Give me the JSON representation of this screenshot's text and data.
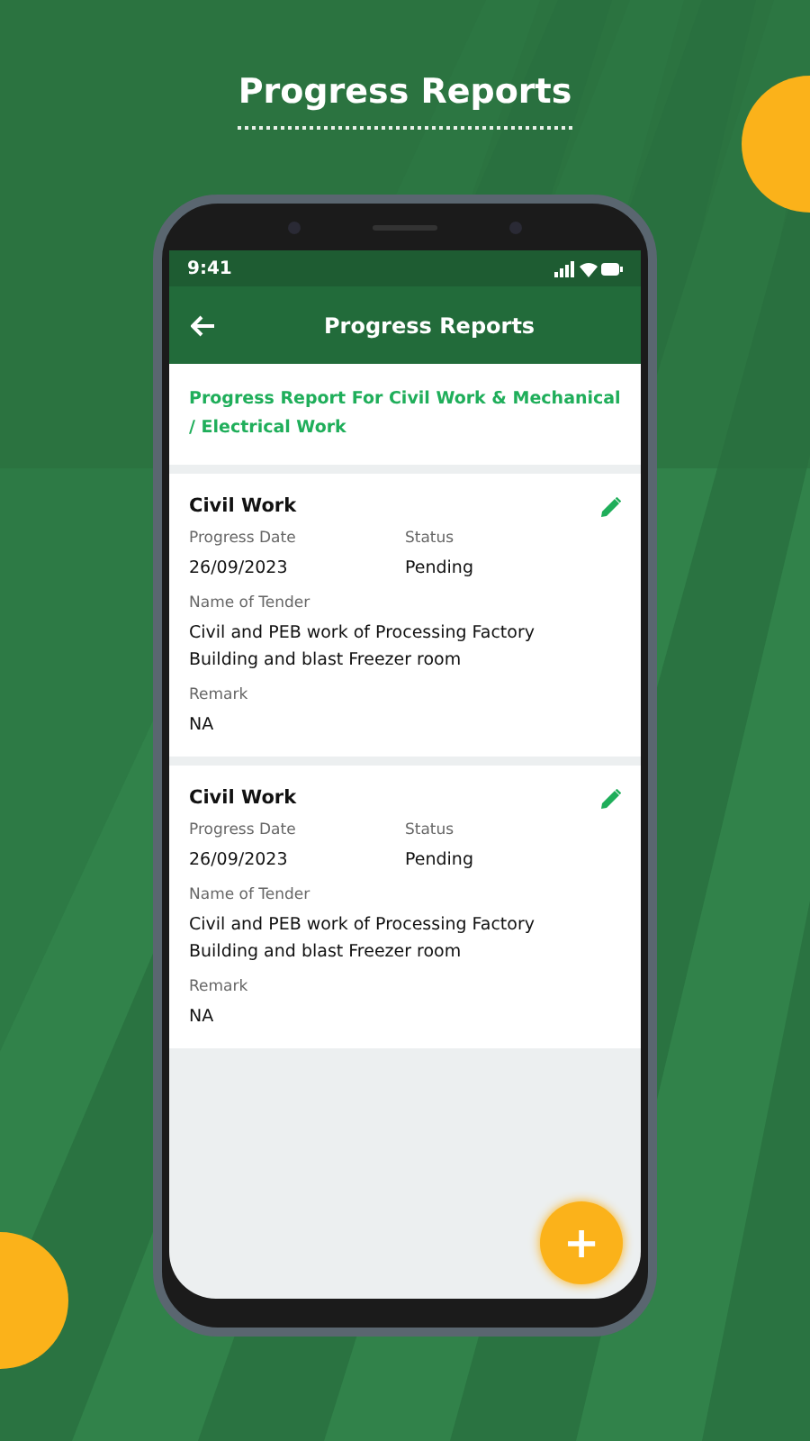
{
  "headline": "Progress Reports",
  "status_bar": {
    "time": "9:41"
  },
  "app_bar": {
    "title": "Progress Reports"
  },
  "section_heading": "Progress Report For Civil Work & Mechanical / Electrical Work",
  "reports": [
    {
      "title": "Civil Work",
      "progress_date_label": "Progress Date",
      "progress_date": "26/09/2023",
      "status_label": "Status",
      "status": "Pending",
      "tender_label": "Name of Tender",
      "tender": "Civil and PEB work of Processing Factory Building and blast Freezer room",
      "remark_label": "Remark",
      "remark": "NA"
    },
    {
      "title": "Civil Work",
      "progress_date_label": "Progress Date",
      "progress_date": "26/09/2023",
      "status_label": "Status",
      "status": "Pending",
      "tender_label": "Name of Tender",
      "tender": "Civil and PEB work of Processing Factory Building and blast Freezer room",
      "remark_label": "Remark",
      "remark": "NA"
    }
  ],
  "fab": {
    "label": "+"
  }
}
